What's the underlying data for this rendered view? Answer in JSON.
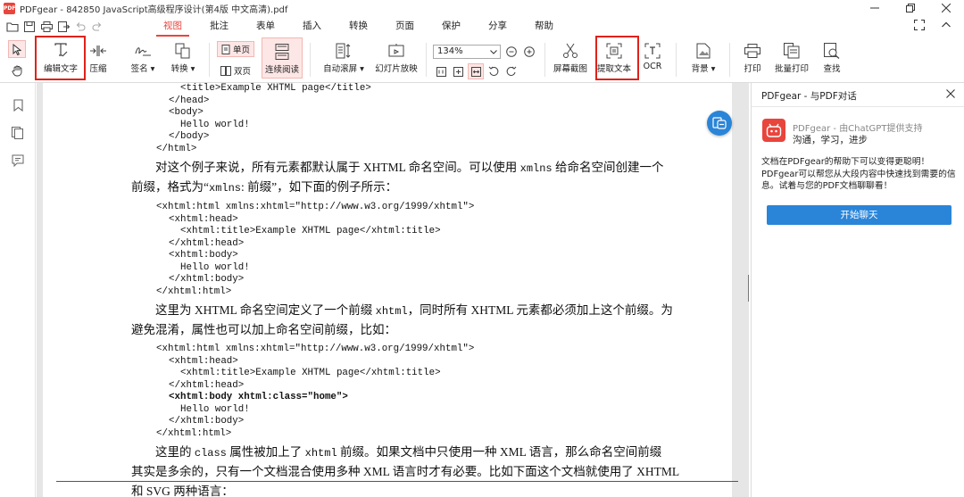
{
  "window": {
    "logo_text": "PDF",
    "title": "PDFgear - 842850 JavaScript高级程序设计(第4版 中文高清).pdf"
  },
  "menu": {
    "tabs": [
      {
        "label": "视图",
        "active": true
      },
      {
        "label": "批注"
      },
      {
        "label": "表单"
      },
      {
        "label": "插入"
      },
      {
        "label": "转换"
      },
      {
        "label": "页面"
      },
      {
        "label": "保护"
      },
      {
        "label": "分享"
      },
      {
        "label": "帮助"
      }
    ]
  },
  "ribbon": {
    "edit_text": "编辑文字",
    "compress": "压缩",
    "sign": "签名 ▾",
    "convert": "转换 ▾",
    "single_page": "单页",
    "double_page": "双页",
    "continuous": "连续阅读",
    "auto_scroll": "自动滚屏 ▾",
    "slideshow": "幻灯片放映",
    "zoom_value": "134%",
    "screenshot": "屏幕截图",
    "extract_text": "提取文本",
    "ocr": "OCR",
    "background": "背景 ▾",
    "print": "打印",
    "batch_print": "批量打印",
    "find": "查找"
  },
  "document": {
    "code_block_1": [
      "<title>Example XHTML page</title>",
      "</head>",
      "<body>",
      "Hello world!",
      "</body>",
      "</html>"
    ],
    "para_1_line_1": [
      "对这个例子来说，所有元素都默认属于 XHTML 命名空间。可以使用 ",
      "xmlns",
      " 给命名空间创建一个"
    ],
    "para_1_line_2": [
      "前缀，格式为“",
      "xmlns",
      ": 前缀”，如下面的例子所示："
    ],
    "code_block_2": [
      "<xhtml:html xmlns:xhtml=\"http://www.w3.org/1999/xhtml\">",
      "<xhtml:head>",
      "<xhtml:title>Example XHTML page</xhtml:title>",
      "</xhtml:head>",
      "<xhtml:body>",
      "Hello world!",
      "</xhtml:body>",
      "</xhtml:html>"
    ],
    "para_2_line_1": [
      "这里为 XHTML 命名空间定义了一个前缀 ",
      "xhtml",
      "，同时所有 XHTML 元素都必须加上这个前缀。为"
    ],
    "para_2_line_2": "避免混淆，属性也可以加上命名空间前缀，比如：",
    "code_block_3": [
      "<xhtml:html xmlns:xhtml=\"http://www.w3.org/1999/xhtml\">",
      "<xhtml:head>",
      "<xhtml:title>Example XHTML page</xhtml:title>",
      "</xhtml:head>",
      "<xhtml:body xhtml:class=\"home\">",
      "Hello world!",
      "</xhtml:body>",
      "</xhtml:html>"
    ],
    "para_3_line_1": [
      "这里的 ",
      "class",
      " 属性被加上了 ",
      "xhtml",
      " 前缀。如果文档中只使用一种 XML 语言，那么命名空间前缀"
    ],
    "para_3_line_2": "其实是多余的，只有一个文档混合使用多种 XML 语言时才有必要。比如下面这个文档就使用了 XHTML",
    "para_3_line_3": "和 SVG 两种语言："
  },
  "chat_panel": {
    "title": "PDFgear - 与PDF对话",
    "bot_name": "PDFgear - 由ChatGPT提供支持",
    "bot_tagline": "沟通，学习，进步",
    "description": "文档在PDFgear的帮助下可以变得更聪明！PDFgear可以帮您从大段内容中快速找到需要的信息。试着与您的PDF文档聊聊看！",
    "start_button": "开始聊天"
  },
  "colors": {
    "accent_red": "#e8453c",
    "highlight_box": "#e0221a",
    "chat_blue": "#2a85d8"
  }
}
